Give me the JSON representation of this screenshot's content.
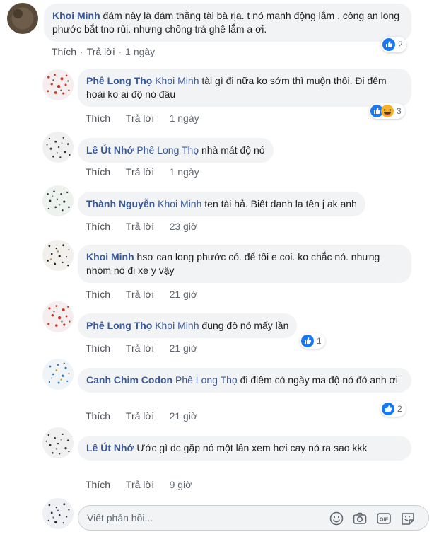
{
  "comments": [
    {
      "author": "Khoi Minh",
      "tag": "",
      "text": "đám này là đám thằng tài bà rịa. t nó manh động lắm . công an long phước bắt tno rùi. nhưng chống trả ghê lắm a ơi.",
      "like": "Thích",
      "reply": "Trả lời",
      "time": "1 ngày",
      "reactions": "2"
    },
    {
      "author": "Phê Long Thọ",
      "tag": "Khoi Minh",
      "text": "tài gì đi nữa ko sớm thì muộn thôi. Đi đêm hoài ko ai độ nó đâu",
      "like": "Thích",
      "reply": "Trả lời",
      "time": "1 ngày",
      "reactions": "3"
    },
    {
      "author": "Lê Út Nhớ",
      "tag": "Phê Long Thọ",
      "text": "nhà mát độ nó",
      "like": "Thích",
      "reply": "Trả lời",
      "time": "1 ngày",
      "reactions": ""
    },
    {
      "author": "Thành Nguyễn",
      "tag": "Khoi Minh",
      "text": "ten tài hả. Biêt danh la tên j ak anh",
      "like": "Thích",
      "reply": "Trả lời",
      "time": "23 giờ",
      "reactions": ""
    },
    {
      "author": "Khoi Minh",
      "tag": "",
      "text": "hsơ can long phước có. để tối e coi. ko chắc nó. nhưng nhóm nó đi xe y vậy",
      "like": "Thích",
      "reply": "Trả lời",
      "time": "21 giờ",
      "reactions": ""
    },
    {
      "author": "Phê Long Thọ",
      "tag": "Khoi Minh",
      "text": "đụng độ nó mấy lần",
      "like": "Thích",
      "reply": "Trả lời",
      "time": "21 giờ",
      "reactions": "1"
    },
    {
      "author": "Canh Chim Codon",
      "tag": "Phê Long Thọ",
      "text": "đi điêm có ngày ma độ nó đó anh ơi",
      "like": "Thích",
      "reply": "Trả lời",
      "time": "21 giờ",
      "reactions": "2"
    },
    {
      "author": "Lê Út Nhớ",
      "tag": "",
      "text": "Ước gì dc gặp nó một lần xem hơi cay nó ra sao kkk",
      "like": "Thích",
      "reply": "Trả lời",
      "time": "9 giờ",
      "reactions": ""
    }
  ],
  "composer": {
    "placeholder": "Viết phản hồi..."
  },
  "icons": [
    "like-icon",
    "haha-icon",
    "emoji-icon",
    "camera-icon",
    "gif-icon",
    "sticker-icon"
  ],
  "colors": {
    "link": "#385898",
    "bubble": "#f2f3f5",
    "like_blue": "#1877f2",
    "haha_yellow": "#f7b125"
  }
}
